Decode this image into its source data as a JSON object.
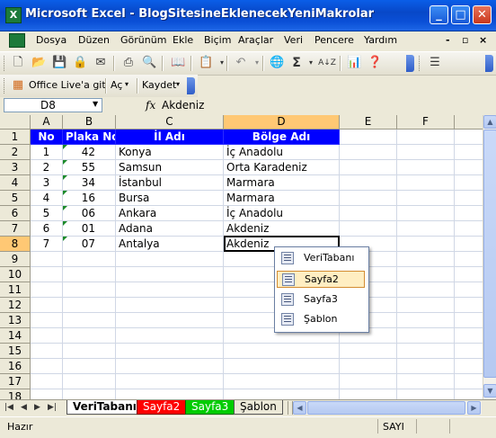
{
  "window": {
    "title": "Microsoft Excel - BlogSitesineEklenecekYeniMakrolar",
    "app_icon": "excel-icon",
    "min_glyph": "_",
    "max_glyph": "□",
    "close_glyph": "✕"
  },
  "menubar": {
    "items": [
      "Dosya",
      "Düzen",
      "Görünüm",
      "Ekle",
      "Biçim",
      "Araçlar",
      "Veri",
      "Pencere",
      "Yardım"
    ],
    "right_controls": [
      "-",
      "▫",
      "×"
    ]
  },
  "toolbar1": {
    "icons": [
      "new-icon",
      "open-icon",
      "save-icon",
      "permission-icon",
      "email-icon",
      "print-icon",
      "print-preview-icon",
      "research-icon",
      "paste-icon",
      "undo-icon",
      "hyperlink-icon",
      "autosum-icon",
      "sort-ascending-icon",
      "chart-icon",
      "help-icon",
      "align-icon"
    ],
    "autosum_label": "Σ",
    "sort_label": "A↓Z"
  },
  "toolbar2": {
    "office_live_label": "Office Live'a git",
    "open_label": "Aç",
    "save_label": "Kaydet"
  },
  "formula_bar": {
    "cell_ref": "D8",
    "fx_label": "fx",
    "content": "Akdeniz"
  },
  "grid": {
    "columns": [
      "A",
      "B",
      "C",
      "D",
      "E",
      "F"
    ],
    "selected_column": "D",
    "rows": [
      "1",
      "2",
      "3",
      "4",
      "5",
      "6",
      "7",
      "8",
      "9",
      "10",
      "11",
      "12",
      "13",
      "14",
      "15",
      "16",
      "17",
      "18"
    ],
    "selected_row": "8",
    "header": {
      "no": "No",
      "plaka": "Plaka No",
      "il": "İl Adı",
      "bolge": "Bölge Adı"
    },
    "data": [
      {
        "no": "1",
        "plaka": "42",
        "il": "Konya",
        "bolge": "İç Anadolu"
      },
      {
        "no": "2",
        "plaka": "55",
        "il": "Samsun",
        "bolge": "Orta Karadeniz"
      },
      {
        "no": "3",
        "plaka": "34",
        "il": "İstanbul",
        "bolge": "Marmara"
      },
      {
        "no": "4",
        "plaka": "16",
        "il": "Bursa",
        "bolge": "Marmara"
      },
      {
        "no": "5",
        "plaka": "06",
        "il": "Ankara",
        "bolge": "İç Anadolu"
      },
      {
        "no": "6",
        "plaka": "01",
        "il": "Adana",
        "bolge": "Akdeniz"
      },
      {
        "no": "7",
        "plaka": "07",
        "il": "Antalya",
        "bolge": "Akdeniz"
      }
    ]
  },
  "popup_list": {
    "items": [
      "VeriTabanı",
      "Sayfa2",
      "Sayfa3",
      "Şablon"
    ],
    "highlighted": "Sayfa2"
  },
  "sheet_tabs": [
    {
      "label": "VeriTabanı",
      "color": "#ffffff",
      "text_color": "#000000",
      "active": true
    },
    {
      "label": "Sayfa2",
      "color": "#ff0000",
      "text_color": "#ffffff",
      "active": false
    },
    {
      "label": "Sayfa3",
      "color": "#00cc00",
      "text_color": "#ffffff",
      "active": false
    },
    {
      "label": "Şablon",
      "color": "#ece9d8",
      "text_color": "#000000",
      "active": false
    }
  ],
  "status": {
    "left": "Hazır",
    "right": "SAYI"
  }
}
